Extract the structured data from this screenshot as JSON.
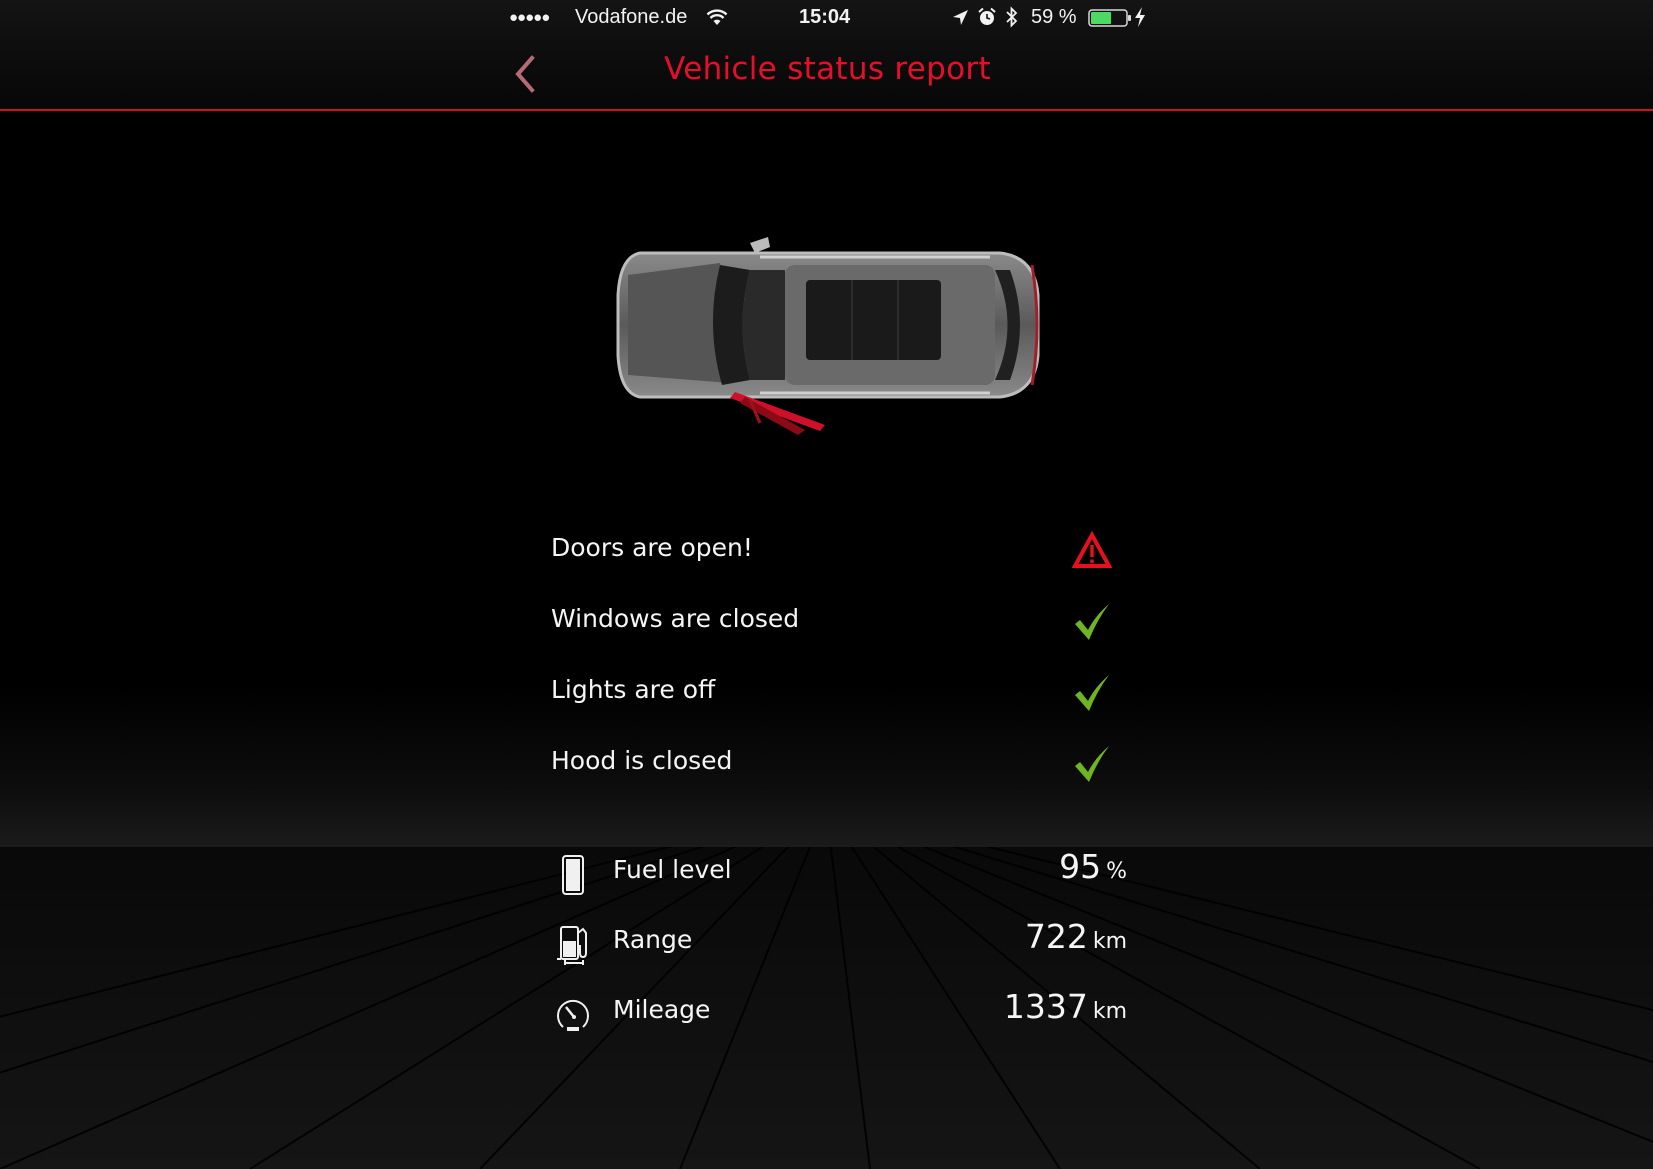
{
  "status_bar": {
    "signal_dots": "●●●●●",
    "carrier": "Vodafone.de",
    "time": "15:04",
    "battery_percent_label": "59 %",
    "battery_level": 0.59,
    "icons": [
      "wifi-icon",
      "location-arrow-icon",
      "alarm-icon",
      "bluetooth-icon",
      "battery-icon",
      "charging-bolt-icon"
    ]
  },
  "nav": {
    "back_icon": "chevron-left-icon",
    "title": "Vehicle status report"
  },
  "vehicle_image": {
    "description": "top view of car with open front-left door highlighted red",
    "open_door_highlight": "#d0102a"
  },
  "status_items": [
    {
      "label": "Doors are open!",
      "state": "warning",
      "icon": "warning-triangle-icon"
    },
    {
      "label": "Windows are closed",
      "state": "ok",
      "icon": "checkmark-icon"
    },
    {
      "label": "Lights are off",
      "state": "ok",
      "icon": "checkmark-icon"
    },
    {
      "label": "Hood is closed",
      "state": "ok",
      "icon": "checkmark-icon"
    }
  ],
  "metrics": [
    {
      "label": "Fuel level",
      "value": "95",
      "unit": "%",
      "icon": "fuel-gauge-icon"
    },
    {
      "label": "Range",
      "value": "722",
      "unit": "km",
      "icon": "fuel-pump-icon"
    },
    {
      "label": "Mileage",
      "value": "1337",
      "unit": "km",
      "icon": "speedometer-icon"
    }
  ],
  "colors": {
    "accent_red": "#e60f2b",
    "back_chevron": "#b56a74",
    "warning_red": "#e8101e",
    "ok_green": "#6fb522",
    "battery_green": "#4cd964"
  }
}
